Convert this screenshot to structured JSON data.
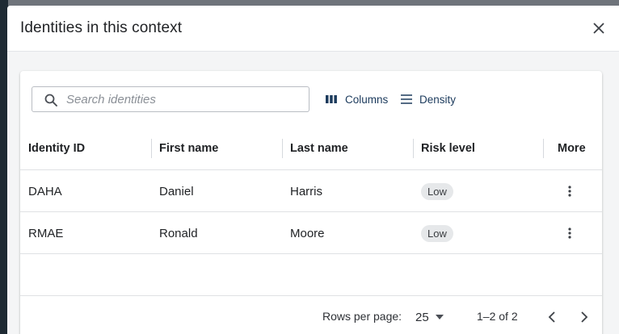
{
  "dialog": {
    "title": "Identities in this context"
  },
  "toolbar": {
    "search_placeholder": "Search identities",
    "columns_label": "Columns",
    "density_label": "Density"
  },
  "table": {
    "columns": [
      "Identity ID",
      "First name",
      "Last name",
      "Risk level",
      "More"
    ],
    "rows": [
      {
        "id": "DAHA",
        "first": "Daniel",
        "last": "Harris",
        "risk": "Low"
      },
      {
        "id": "RMAE",
        "first": "Ronald",
        "last": "Moore",
        "risk": "Low"
      }
    ]
  },
  "pagination": {
    "rows_per_page_label": "Rows per page:",
    "rows_per_page_value": "25",
    "range": "1–2 of 2"
  },
  "colors": {
    "accent": "#1b3a5c",
    "chip_bg": "#e6e8ea",
    "backdrop": "#5b6068"
  }
}
